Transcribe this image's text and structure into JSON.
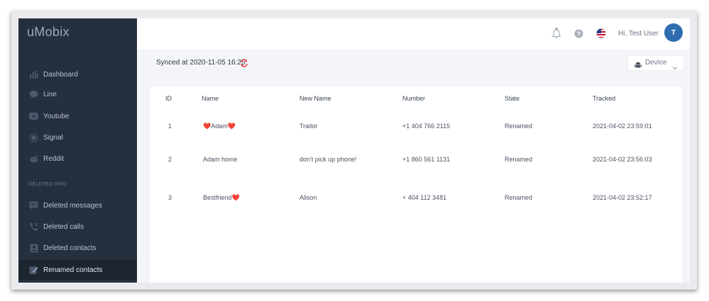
{
  "app": {
    "brand": "uMobix"
  },
  "sidebar": {
    "items": [
      {
        "label": "Dashboard",
        "icon": "bar-chart-icon"
      },
      {
        "label": "Line",
        "icon": "line-app-icon"
      },
      {
        "label": "Youtube",
        "icon": "youtube-icon"
      },
      {
        "label": "Signal",
        "icon": "signal-icon"
      },
      {
        "label": "Reddit",
        "icon": "reddit-icon"
      }
    ],
    "section_label": "DELETED INFO",
    "deleted_items": [
      {
        "label": "Deleted messages",
        "icon": "message-icon"
      },
      {
        "label": "Deleted calls",
        "icon": "phone-icon"
      },
      {
        "label": "Deleted contacts",
        "icon": "contact-card-icon"
      },
      {
        "label": "Renamed contacts",
        "icon": "edit-icon",
        "active": true
      }
    ]
  },
  "header": {
    "greeting": "Hi, Test User",
    "avatar_initial": "T",
    "icons": [
      "bell-icon",
      "help-icon",
      "us-flag-icon"
    ]
  },
  "sync": {
    "text": "Synced at 2020-11-05 16:25",
    "device_label": "Device"
  },
  "table": {
    "headers": [
      "ID",
      "Name",
      "New Name",
      "Number",
      "State",
      "Tracked"
    ],
    "rows": [
      {
        "id": "1",
        "name": "❤️Adam❤️",
        "new_name": "Traitor",
        "number": "+1 404 766 2115",
        "state": "Renamed",
        "tracked": "2021-04-02 23:59:01"
      },
      {
        "id": "2",
        "name": "Adam home",
        "new_name": "don't pick up phone!",
        "number": "+1 860 561 1131",
        "state": "Renamed",
        "tracked": "2021-04-02 23:56:03"
      },
      {
        "id": "3",
        "name": "Bestfriend❤️",
        "new_name": "Alison",
        "number": "+ 404 112 3481",
        "state": "Renamed",
        "tracked": "2021-04-02 23:52:17"
      }
    ]
  },
  "colors": {
    "sidebar_bg": "#262f3e",
    "accent": "#2f6db0",
    "sync_icon": "#e53935"
  }
}
